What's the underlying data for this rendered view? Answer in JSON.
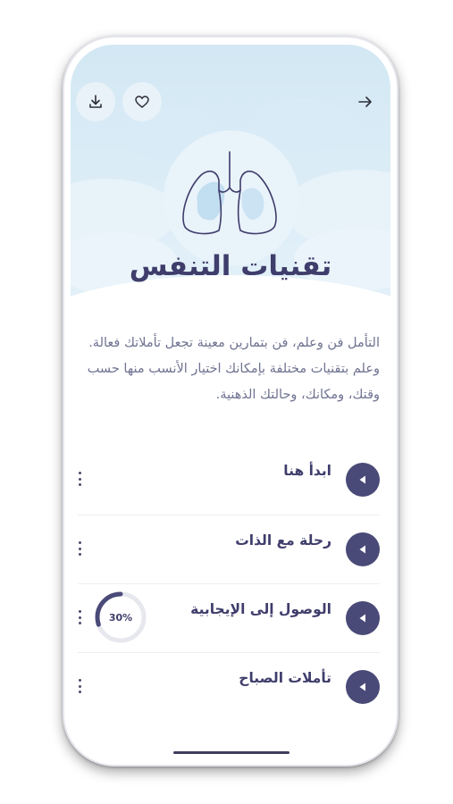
{
  "colors": {
    "hero_bg": "#d3e8f4",
    "accent": "#4a4a78",
    "title": "#3f3d6b",
    "body_text": "#6f7391",
    "progress_track": "#e6e8ee"
  },
  "header": {
    "back_icon": "arrow-right-icon",
    "favorite_icon": "heart-icon",
    "download_icon": "download-icon"
  },
  "hero": {
    "illustration_icon": "lungs-icon",
    "title": "تقنيات التنفس"
  },
  "description": "التأمل فن وعلم، فن بتمارين معينة تجعل تأملاتك فعالة. وعلم بتقنيات مختلفة بإمكانك اختيار الأنسب منها حسب وقتك، ومكانك، وحالتك الذهنية.",
  "lessons": [
    {
      "title": "ابدأ هنا",
      "play_icon": "play-icon",
      "menu_icon": "kebab-menu-icon"
    },
    {
      "title": "رحلة مع الذات",
      "play_icon": "play-icon",
      "menu_icon": "kebab-menu-icon"
    },
    {
      "title": "الوصول إلى الإيجابية",
      "play_icon": "play-icon",
      "menu_icon": "kebab-menu-icon",
      "progress": 0.3,
      "progress_label": "30%"
    },
    {
      "title": "تأملات الصباح",
      "play_icon": "play-icon",
      "menu_icon": "kebab-menu-icon"
    }
  ]
}
